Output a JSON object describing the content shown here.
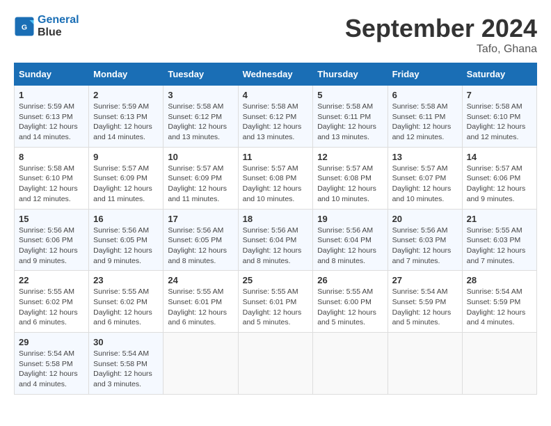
{
  "header": {
    "logo_line1": "General",
    "logo_line2": "Blue",
    "month": "September 2024",
    "location": "Tafo, Ghana"
  },
  "weekdays": [
    "Sunday",
    "Monday",
    "Tuesday",
    "Wednesday",
    "Thursday",
    "Friday",
    "Saturday"
  ],
  "weeks": [
    [
      {
        "day": "1",
        "sunrise": "5:59 AM",
        "sunset": "6:13 PM",
        "daylight": "12 hours and 14 minutes."
      },
      {
        "day": "2",
        "sunrise": "5:59 AM",
        "sunset": "6:13 PM",
        "daylight": "12 hours and 14 minutes."
      },
      {
        "day": "3",
        "sunrise": "5:58 AM",
        "sunset": "6:12 PM",
        "daylight": "12 hours and 13 minutes."
      },
      {
        "day": "4",
        "sunrise": "5:58 AM",
        "sunset": "6:12 PM",
        "daylight": "12 hours and 13 minutes."
      },
      {
        "day": "5",
        "sunrise": "5:58 AM",
        "sunset": "6:11 PM",
        "daylight": "12 hours and 13 minutes."
      },
      {
        "day": "6",
        "sunrise": "5:58 AM",
        "sunset": "6:11 PM",
        "daylight": "12 hours and 12 minutes."
      },
      {
        "day": "7",
        "sunrise": "5:58 AM",
        "sunset": "6:10 PM",
        "daylight": "12 hours and 12 minutes."
      }
    ],
    [
      {
        "day": "8",
        "sunrise": "5:58 AM",
        "sunset": "6:10 PM",
        "daylight": "12 hours and 12 minutes."
      },
      {
        "day": "9",
        "sunrise": "5:57 AM",
        "sunset": "6:09 PM",
        "daylight": "12 hours and 11 minutes."
      },
      {
        "day": "10",
        "sunrise": "5:57 AM",
        "sunset": "6:09 PM",
        "daylight": "12 hours and 11 minutes."
      },
      {
        "day": "11",
        "sunrise": "5:57 AM",
        "sunset": "6:08 PM",
        "daylight": "12 hours and 10 minutes."
      },
      {
        "day": "12",
        "sunrise": "5:57 AM",
        "sunset": "6:08 PM",
        "daylight": "12 hours and 10 minutes."
      },
      {
        "day": "13",
        "sunrise": "5:57 AM",
        "sunset": "6:07 PM",
        "daylight": "12 hours and 10 minutes."
      },
      {
        "day": "14",
        "sunrise": "5:57 AM",
        "sunset": "6:06 PM",
        "daylight": "12 hours and 9 minutes."
      }
    ],
    [
      {
        "day": "15",
        "sunrise": "5:56 AM",
        "sunset": "6:06 PM",
        "daylight": "12 hours and 9 minutes."
      },
      {
        "day": "16",
        "sunrise": "5:56 AM",
        "sunset": "6:05 PM",
        "daylight": "12 hours and 9 minutes."
      },
      {
        "day": "17",
        "sunrise": "5:56 AM",
        "sunset": "6:05 PM",
        "daylight": "12 hours and 8 minutes."
      },
      {
        "day": "18",
        "sunrise": "5:56 AM",
        "sunset": "6:04 PM",
        "daylight": "12 hours and 8 minutes."
      },
      {
        "day": "19",
        "sunrise": "5:56 AM",
        "sunset": "6:04 PM",
        "daylight": "12 hours and 8 minutes."
      },
      {
        "day": "20",
        "sunrise": "5:56 AM",
        "sunset": "6:03 PM",
        "daylight": "12 hours and 7 minutes."
      },
      {
        "day": "21",
        "sunrise": "5:55 AM",
        "sunset": "6:03 PM",
        "daylight": "12 hours and 7 minutes."
      }
    ],
    [
      {
        "day": "22",
        "sunrise": "5:55 AM",
        "sunset": "6:02 PM",
        "daylight": "12 hours and 6 minutes."
      },
      {
        "day": "23",
        "sunrise": "5:55 AM",
        "sunset": "6:02 PM",
        "daylight": "12 hours and 6 minutes."
      },
      {
        "day": "24",
        "sunrise": "5:55 AM",
        "sunset": "6:01 PM",
        "daylight": "12 hours and 6 minutes."
      },
      {
        "day": "25",
        "sunrise": "5:55 AM",
        "sunset": "6:01 PM",
        "daylight": "12 hours and 5 minutes."
      },
      {
        "day": "26",
        "sunrise": "5:55 AM",
        "sunset": "6:00 PM",
        "daylight": "12 hours and 5 minutes."
      },
      {
        "day": "27",
        "sunrise": "5:54 AM",
        "sunset": "5:59 PM",
        "daylight": "12 hours and 5 minutes."
      },
      {
        "day": "28",
        "sunrise": "5:54 AM",
        "sunset": "5:59 PM",
        "daylight": "12 hours and 4 minutes."
      }
    ],
    [
      {
        "day": "29",
        "sunrise": "5:54 AM",
        "sunset": "5:58 PM",
        "daylight": "12 hours and 4 minutes."
      },
      {
        "day": "30",
        "sunrise": "5:54 AM",
        "sunset": "5:58 PM",
        "daylight": "12 hours and 3 minutes."
      },
      null,
      null,
      null,
      null,
      null
    ]
  ]
}
